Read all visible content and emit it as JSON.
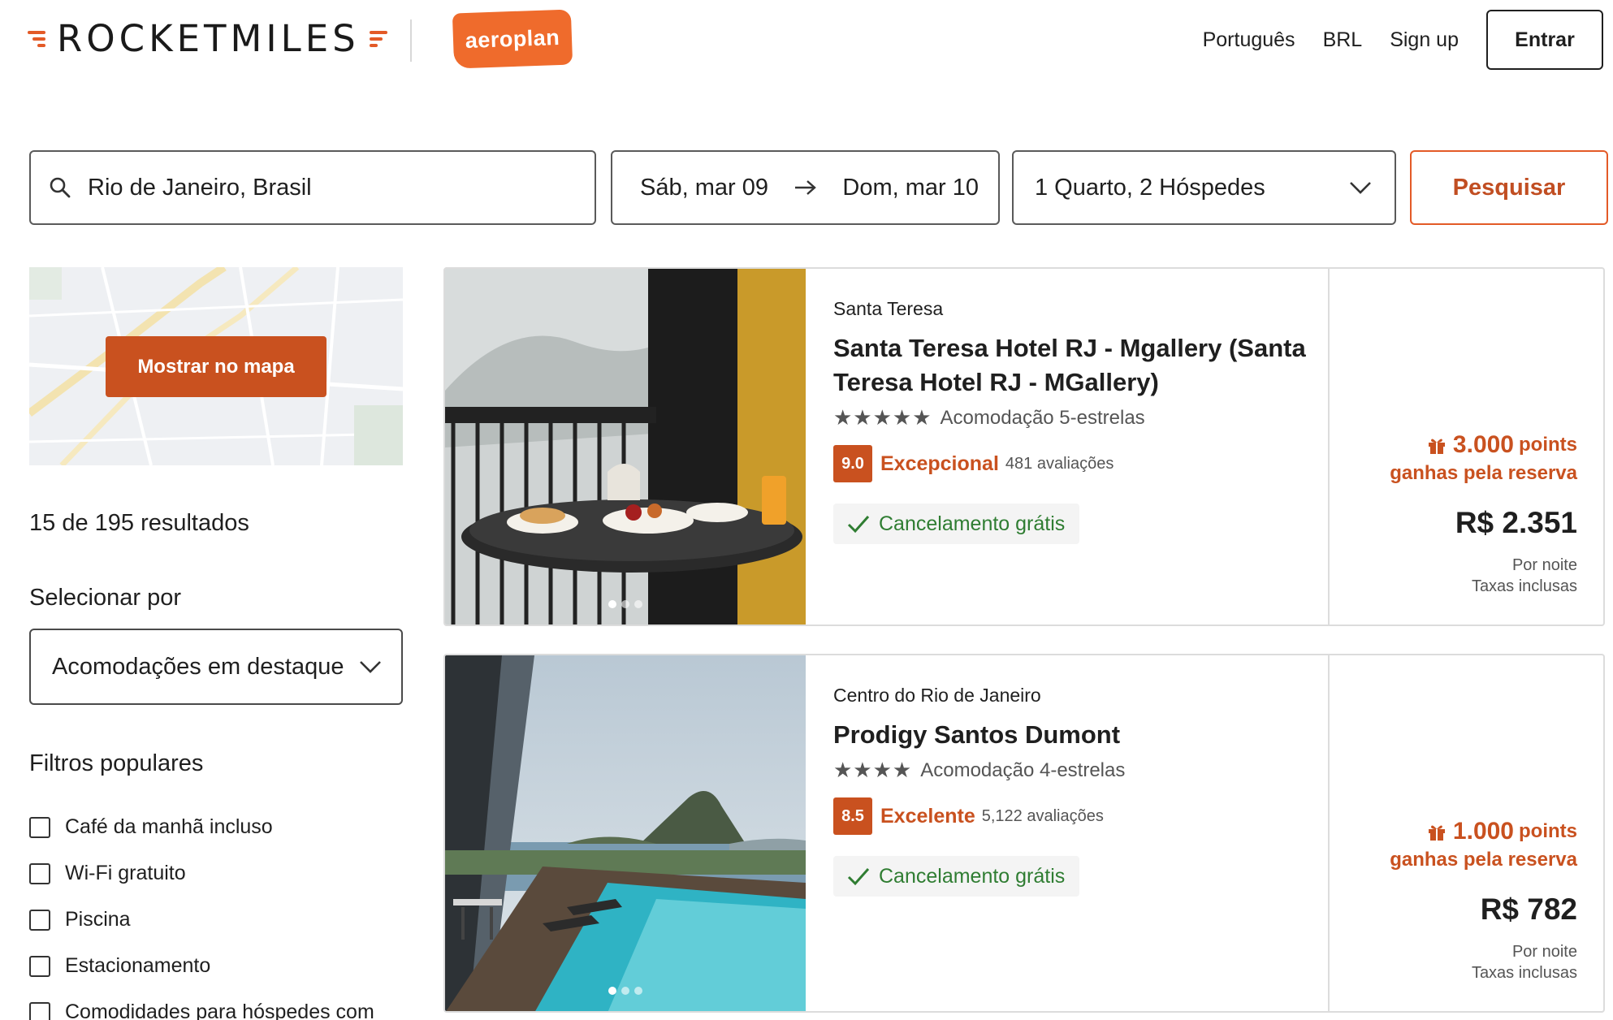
{
  "header": {
    "brand": "ROCKETMILES",
    "partner": "aeroplan",
    "nav": {
      "language": "Português",
      "currency": "BRL",
      "signup": "Sign up",
      "login": "Entrar"
    }
  },
  "search": {
    "destination": "Rio de Janeiro, Brasil",
    "checkin": "Sáb, mar 09",
    "checkout": "Dom, mar 10",
    "guests": "1 Quarto, 2 Hóspedes",
    "button": "Pesquisar"
  },
  "sidebar": {
    "map_button": "Mostrar no mapa",
    "results_count": "15 de 195 resultados",
    "sort_label": "Selecionar por",
    "sort_value": "Acomodações em destaque",
    "filters_title": "Filtros populares",
    "filters": [
      {
        "label": "Café da manhã incluso",
        "checked": false
      },
      {
        "label": "Wi-Fi gratuito",
        "checked": false
      },
      {
        "label": "Piscina",
        "checked": false
      },
      {
        "label": "Estacionamento",
        "checked": false
      },
      {
        "label": "Comodidades para hóspedes com",
        "checked": false
      }
    ]
  },
  "hotels": [
    {
      "neighborhood": "Santa Teresa",
      "name": "Santa Teresa Hotel RJ - Mgallery (Santa Teresa Hotel RJ - MGallery)",
      "stars": "★★★★★",
      "star_count": 5,
      "stars_label": "Acomodação 5-estrelas",
      "score": "9.0",
      "rating_word": "Excepcional",
      "reviews": "481 avaliações",
      "cancellation": "Cancelamento grátis",
      "points": "3.000",
      "points_unit": "points",
      "points_sub": "ganhas pela reserva",
      "price": "R$ 2.351",
      "price_note_1": "Por noite",
      "price_note_2": "Taxas inclusas",
      "photo_index": 0,
      "photo_count": 3
    },
    {
      "neighborhood": "Centro do Rio de Janeiro",
      "name": "Prodigy Santos Dumont",
      "stars": "★★★★",
      "star_count": 4,
      "stars_label": "Acomodação 4-estrelas",
      "score": "8.5",
      "rating_word": "Excelente",
      "reviews": "5,122 avaliações",
      "cancellation": "Cancelamento grátis",
      "points": "1.000",
      "points_unit": "points",
      "points_sub": "ganhas pela reserva",
      "price": "R$ 782",
      "price_note_1": "Por noite",
      "price_note_2": "Taxas inclusas",
      "photo_index": 0,
      "photo_count": 3
    }
  ],
  "colors": {
    "brand_orange": "#e35a27",
    "accent_dark_orange": "#c9511f",
    "success_green": "#2f7d32",
    "aeroplan_orange": "#ef6b2c"
  },
  "icons": {
    "search": "search-icon",
    "arrow": "arrow-right-icon",
    "chevron": "chevron-down-icon",
    "check": "check-icon",
    "gift": "gift-icon"
  }
}
